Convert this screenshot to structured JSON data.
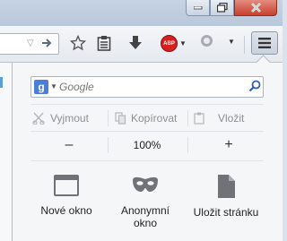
{
  "toolbar": {
    "url_dropmarker_icon": "triangle-down-icon",
    "go_icon": "arrow-right-icon",
    "bookmark_icon": "star-icon",
    "reader_icon": "clipboard-icon",
    "downloads_icon": "download-arrow-icon",
    "adblock_label": "ABP",
    "menu_icon": "hamburger-menu-icon"
  },
  "panel": {
    "search": {
      "engine_icon": "google-g-icon",
      "engine_letter": "g",
      "placeholder": "Google"
    },
    "edit": {
      "cut": "Vyjmout",
      "copy": "Kopírovat",
      "paste": "Vložit"
    },
    "zoom": {
      "minus": "–",
      "value": "100%",
      "plus": "+"
    },
    "actions": [
      {
        "label": "Nové okno"
      },
      {
        "label_line1": "Anonymní",
        "label_line2": "okno"
      },
      {
        "label": "Uložit stránku"
      }
    ]
  },
  "colors": {
    "accent": "#4a7ed8",
    "adblock_red": "#d71f1f",
    "disabled_text": "#8c8f93"
  }
}
